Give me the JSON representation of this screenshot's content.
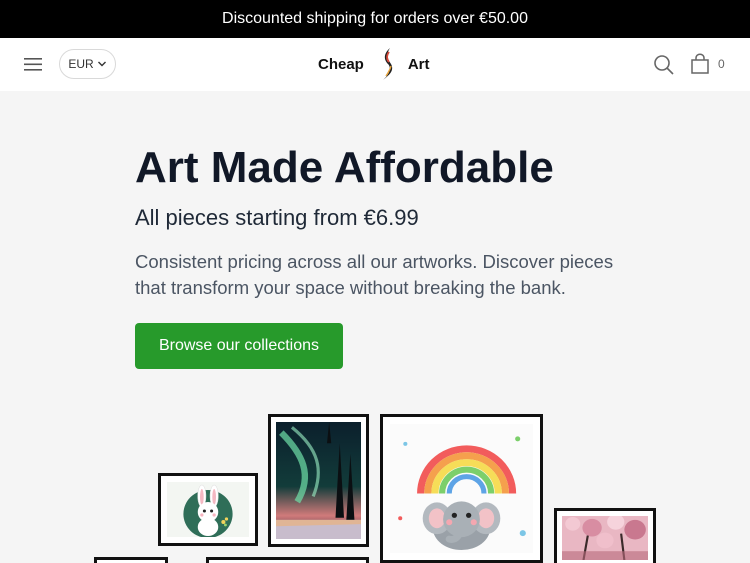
{
  "announcement": {
    "text": "Discounted shipping for orders over €50.00"
  },
  "header": {
    "currency": "EUR",
    "logo_left": "Cheap",
    "logo_right": "Art",
    "cart_count": "0"
  },
  "hero": {
    "headline": "Art Made Affordable",
    "subheadline": "All pieces starting from €6.99",
    "description": "Consistent pricing across all our artworks. Discover pieces that transform your space without breaking the bank.",
    "cta_label": "Browse our collections"
  },
  "colors": {
    "announcement_bg": "#000000",
    "cta_bg": "#279a2b",
    "page_bg": "#f5f5f5"
  },
  "icons": [
    "menu-icon",
    "chevron-down-icon",
    "search-icon",
    "shopping-bag-icon"
  ]
}
